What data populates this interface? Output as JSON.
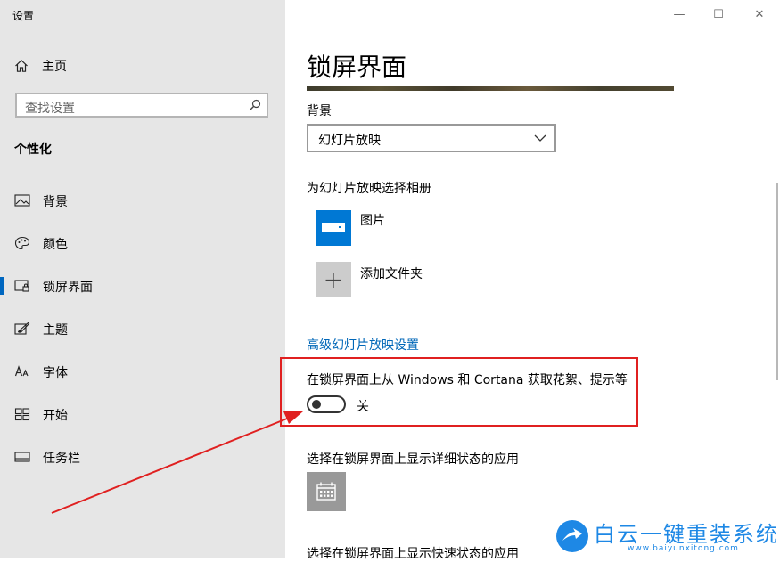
{
  "app_title": "设置",
  "window_controls": {
    "minimize": "—",
    "maximize": "☐",
    "close": "✕"
  },
  "sidebar": {
    "home_label": "主页",
    "search_placeholder": "查找设置",
    "section_title": "个性化",
    "items": [
      {
        "label": "背景",
        "icon": "picture-icon",
        "active": false
      },
      {
        "label": "颜色",
        "icon": "palette-icon",
        "active": false
      },
      {
        "label": "锁屏界面",
        "icon": "lock-screen-icon",
        "active": true
      },
      {
        "label": "主题",
        "icon": "theme-brush-icon",
        "active": false
      },
      {
        "label": "字体",
        "icon": "font-icon",
        "active": false
      },
      {
        "label": "开始",
        "icon": "start-grid-icon",
        "active": false
      },
      {
        "label": "任务栏",
        "icon": "taskbar-icon",
        "active": false
      }
    ]
  },
  "main": {
    "title": "锁屏界面",
    "background_label": "背景",
    "background_value": "幻灯片放映",
    "album_heading": "为幻灯片放映选择相册",
    "albums": [
      {
        "label": "图片",
        "icon": "pictures-folder-icon"
      },
      {
        "label": "添加文件夹",
        "icon": "plus-icon"
      }
    ],
    "advanced_link": "高级幻灯片放映设置",
    "tips_label": "在锁屏界面上从 Windows 和 Cortana 获取花絮、提示等",
    "tips_state": "关",
    "detailed_status_label": "选择在锁屏界面上显示详细状态的应用",
    "quick_status_label": "选择在锁屏界面上显示快速状态的应用"
  },
  "watermark": {
    "text": "白云一键重装系统",
    "url": "www.baiyunxitong.com"
  },
  "colors": {
    "accent": "#0078d4",
    "link": "#0067b8",
    "highlight": "#e02020",
    "sidebar_bg": "#e6e6e6"
  }
}
